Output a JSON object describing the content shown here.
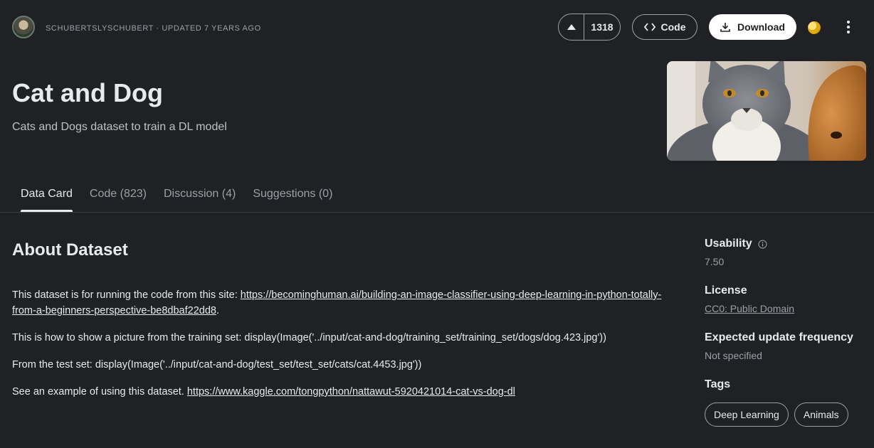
{
  "header": {
    "byline": "SCHUBERTSLYSCHUBERT · UPDATED 7 YEARS AGO",
    "vote_count": "1318",
    "code_label": "Code",
    "download_label": "Download"
  },
  "dataset": {
    "title": "Cat and Dog",
    "subtitle": "Cats and Dogs dataset to train a DL model"
  },
  "tabs": [
    {
      "label": "Data Card",
      "active": true
    },
    {
      "label": "Code (823)",
      "active": false
    },
    {
      "label": "Discussion (4)",
      "active": false
    },
    {
      "label": "Suggestions (0)",
      "active": false
    }
  ],
  "about": {
    "heading": "About Dataset",
    "p1_text": "This dataset is for running the code from this site: ",
    "p1_link": "https://becominghuman.ai/building-an-image-classifier-using-deep-learning-in-python-totally-from-a-beginners-perspective-be8dbaf22dd8",
    "p1_end": ".",
    "p2": "This is how to show a picture from the training set: display(Image('../input/cat-and-dog/training_set/training_set/dogs/dog.423.jpg'))",
    "p3": "From the test set: display(Image('../input/cat-and-dog/test_set/test_set/cats/cat.4453.jpg'))",
    "p4_text": "See an example of using this dataset. ",
    "p4_link": "https://www.kaggle.com/tongpython/nattawut-5920421014-cat-vs-dog-dl"
  },
  "sidebar": {
    "usability_label": "Usability",
    "usability_value": "7.50",
    "license_label": "License",
    "license_value": "CC0: Public Domain",
    "frequency_label": "Expected update frequency",
    "frequency_value": "Not specified",
    "tags_label": "Tags",
    "tags": [
      "Deep Learning",
      "Animals"
    ]
  },
  "colors": {
    "background": "#202124",
    "text": "#e8eaed",
    "muted": "#9aa0a6",
    "medal": "#e2a80f"
  },
  "icons": [
    "avatar",
    "arrow-up-icon",
    "code-icon",
    "download-icon",
    "medal-icon",
    "more-vert-icon",
    "info-icon"
  ]
}
